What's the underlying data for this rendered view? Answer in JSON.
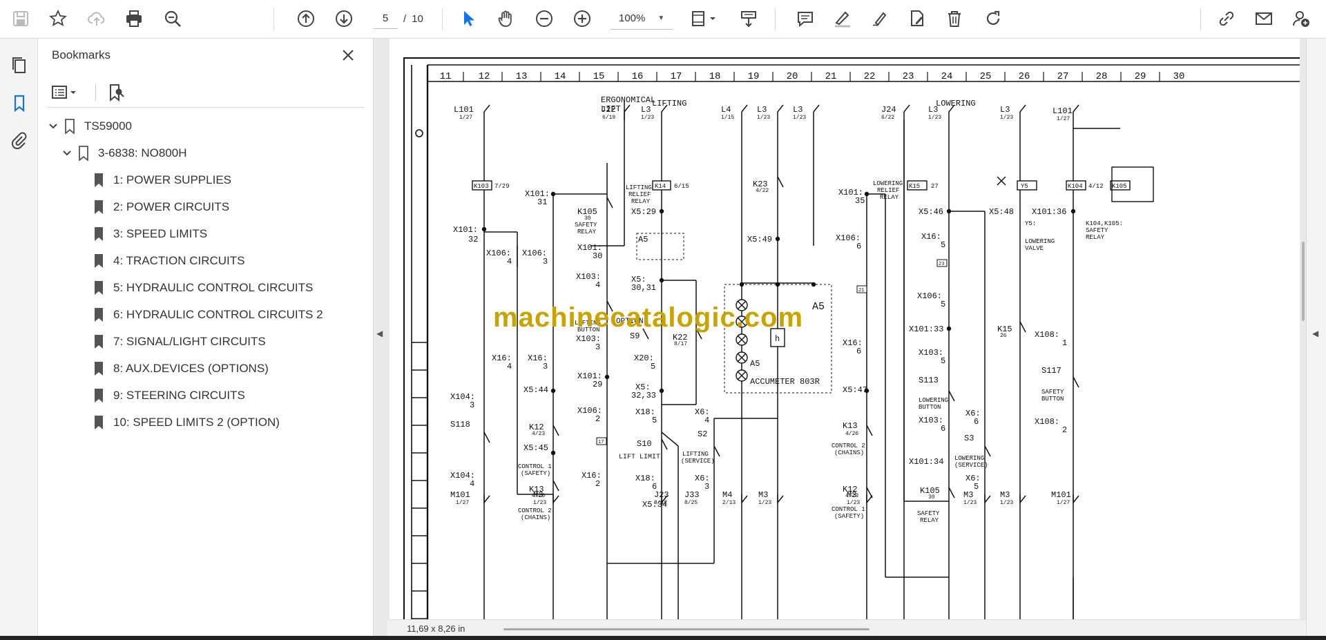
{
  "toolbar": {
    "page_current": "5",
    "page_total": "10",
    "zoom": "100%"
  },
  "bookmarks": {
    "title": "Bookmarks",
    "root": "TS59000",
    "group": "3-6838: NO800H",
    "items": [
      "1: POWER SUPPLIES",
      "2: POWER CIRCUITS",
      "3: SPEED LIMITS",
      "4: TRACTION CIRCUITS",
      "5: HYDRAULIC CONTROL CIRCUITS",
      "6: HYDRAULIC CONTROL CIRCUITS 2",
      "7: SIGNAL/LIGHT CIRCUITS",
      "8: AUX.DEVICES (OPTIONS)",
      "9: STEERING CIRCUITS",
      "10: SPEED LIMITS 2 (OPTION)"
    ]
  },
  "status": {
    "page_size": "11,69 x 8,26 in"
  },
  "document": {
    "watermark": "machinecatalogic.com",
    "column_numbers": [
      "11",
      "12",
      "13",
      "14",
      "15",
      "16",
      "17",
      "18",
      "19",
      "20",
      "21",
      "22",
      "23",
      "24",
      "25",
      "26",
      "27",
      "28",
      "29",
      "30"
    ],
    "section_titles": {
      "ergonomical": "ERGONOMICAL",
      "lift": "LIFT",
      "lifting": "LIFTING",
      "lowering": "LOWERING"
    },
    "top_refs": [
      {
        "id": "L101",
        "ref": "1/27"
      },
      {
        "id": "J22",
        "ref": "6/19"
      },
      {
        "id": "L3",
        "ref": "1/23"
      },
      {
        "id": "L4",
        "ref": "1/15"
      },
      {
        "id": "L3",
        "ref": "1/23"
      },
      {
        "id": "L3",
        "ref": "1/23"
      },
      {
        "id": "J24",
        "ref": "6/22"
      },
      {
        "id": "L3",
        "ref": "1/23"
      },
      {
        "id": "L3",
        "ref": "1/23"
      },
      {
        "id": "L101",
        "ref": "1/27"
      }
    ],
    "bottom_refs": [
      {
        "id": "M101",
        "ref": "1/27"
      },
      {
        "id": "M3",
        "ref": "1/23"
      },
      {
        "id": "J23",
        "ref": "8/12"
      },
      {
        "id": "J33",
        "ref": "8/25"
      },
      {
        "id": "M4",
        "ref": "2/13"
      },
      {
        "id": "M3",
        "ref": "1/23"
      },
      {
        "id": "M3",
        "ref": "1/23"
      },
      {
        "id": "M3",
        "ref": "1/23"
      },
      {
        "id": "M3",
        "ref": "1/23"
      },
      {
        "id": "M101",
        "ref": "1/27"
      }
    ],
    "relays": {
      "k103": "K103",
      "k103_ref": "7/29",
      "k14": "K14",
      "k14_ref": "6/15",
      "k14_desc1": "LIFTING",
      "k14_desc2": "RELIEF",
      "k14_desc3": "RELAY",
      "k15": "K15",
      "k15_ref": "27",
      "k15_desc1": "LOWERING",
      "k15_desc2": "RELIEF",
      "k15_desc3": "RELAY",
      "y5": "Y5",
      "k104": "K104",
      "k104_ref": "4/12",
      "k105": "K105",
      "k104_note1": "K104,K105:",
      "k104_note2": "SAFETY",
      "k104_note3": "RELAY",
      "y5_note1": "Y5:",
      "y5_note2": "LOWERING",
      "y5_note3": "VALVE"
    },
    "labels": {
      "x101_31": "X101:",
      "x101_31b": "31",
      "k105": "K105",
      "k105_ref": "30",
      "k105_d1": "SAFETY",
      "k105_d2": "RELAY",
      "x5_29": "X5:29",
      "x101_32": "X101:",
      "x101_32b": "32",
      "x101_30": "X101:",
      "x101_30b": "30",
      "x106_4": "X106:",
      "x106_4b": "4",
      "x106_3": "X106:",
      "x106_3b": "3",
      "x103_4": "X103:",
      "x103_4b": "4",
      "x5_3031": "X5:",
      "x5_3031b": "30,31",
      "s12_d1": "LIFTING",
      "s12_d2": "BUTTON",
      "x103_3": "X103:",
      "x103_3b": "3",
      "option": "OPTION",
      "s9": "S9",
      "k22": "K22",
      "k22_ref": "8/17",
      "x16_4": "X16:",
      "x16_4b": "4",
      "x16_3": "X16:",
      "x16_3b": "3",
      "x101_29": "X101:",
      "x101_29b": "29",
      "x20_5": "X20:",
      "x20_5b": "5",
      "x5_44": "X5:44",
      "x5_3233": "X5:",
      "x5_3233b": "32,33",
      "x104_3": "X104:",
      "x104_3b": "3",
      "x106_2": "X106:",
      "x106_2b": "2",
      "x18_5": "X18:",
      "x18_5b": "5",
      "x6_4": "X6:",
      "x6_4b": "4",
      "s118": "S118",
      "k12": "K12",
      "k12_ref": "4/23",
      "s10": "S10",
      "s10_d": "LIFT LIMIT",
      "s2": "S2",
      "s2_d1": "LIFTING",
      "s2_d2": "(SERVICE)",
      "x5_45": "X5:45",
      "c1_d1": "CONTROL 1",
      "c1_d2": "(SAFETY)",
      "x104_4": "X104:",
      "x104_4b": "4",
      "x16_2": "X16:",
      "x16_2b": "2",
      "x18_6": "X18:",
      "x18_6b": "6",
      "x6_3": "X6:",
      "x6_3b": "3",
      "k13": "K13",
      "k13_ref": "4/26",
      "c2_d1": "CONTROL 2",
      "c2_d2": "(CHAINS)",
      "x5_34": "X5:34",
      "a5": "A5",
      "a5_small": "A5",
      "accumeter": "ACCUMETER 803R",
      "h": "h",
      "k23": "K23",
      "k23_ref": "4/22",
      "x5_49": "X5:49",
      "x101_35": "X101:",
      "x101_35b": "35",
      "x106_6": "X106:",
      "x106_6b": "6",
      "x16_6": "X16:",
      "x16_6b": "6",
      "x5_47": "X5:47",
      "k13r": "K13",
      "k13r_ref": "4/26",
      "c2r_d1": "CONTROL 2",
      "c2r_d2": "(CHAINS)",
      "k12r": "K12",
      "k12r_ref": "4/23",
      "c1r_d1": "CONTROL 1",
      "c1r_d2": "(SAFETY)",
      "x5_46": "X5:46",
      "x5_48": "X5:48",
      "x16_5": "X16:",
      "x16_5b": "5",
      "x106_5": "X106:",
      "x106_5b": "5",
      "x101_33": "X101:33",
      "x103_5": "X103:",
      "x103_5b": "5",
      "s113": "S113",
      "s113_d1": "LOWERING",
      "s113_d2": "BUTTON",
      "x103_6": "X103:",
      "x103_6b": "6",
      "x101_34": "X101:34",
      "k105r": "K105",
      "k105r_ref": "30",
      "k105r_d1": "SAFETY",
      "k105r_d2": "RELAY",
      "x6_6": "X6:",
      "x6_6b": "6",
      "s3": "S3",
      "s3_d1": "LOWERING",
      "s3_d2": "(SERVICE)",
      "x6_5": "X6:",
      "x6_5b": "5",
      "k15b": "K15",
      "k15b_ref": "26",
      "x101_36": "X101:36",
      "x108_1": "X108:",
      "x108_1b": "1",
      "s117": "S117",
      "s117_d1": "SAFETY",
      "s117_d2": "BUTTON",
      "x108_2": "X108:",
      "x108_2b": "2",
      "box17": "17",
      "box21": "21",
      "box23": "23"
    }
  }
}
